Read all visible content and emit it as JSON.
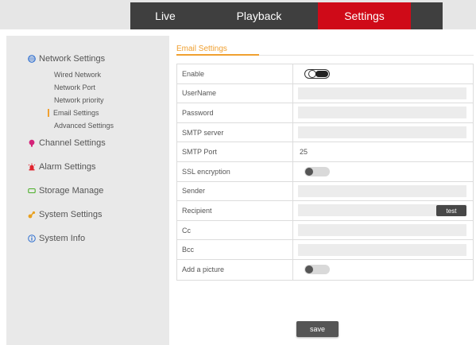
{
  "topnav": {
    "tabs": [
      {
        "label": "Live"
      },
      {
        "label": "Playback"
      },
      {
        "label": "Settings",
        "active": true
      }
    ],
    "accent_color": "#cf0a18"
  },
  "sidebar": {
    "network": {
      "label": "Network Settings",
      "icon": "network-icon",
      "items": [
        {
          "label": "Wired Network"
        },
        {
          "label": "Network Port"
        },
        {
          "label": "Network priority"
        },
        {
          "label": "Email Settings",
          "active": true
        },
        {
          "label": "Advanced Settings"
        }
      ]
    },
    "channel": {
      "label": "Channel Settings",
      "icon": "channel-icon"
    },
    "alarm": {
      "label": "Alarm Settings",
      "icon": "alarm-icon"
    },
    "storage": {
      "label": "Storage Manage",
      "icon": "storage-icon"
    },
    "system": {
      "label": "System Settings",
      "icon": "system-icon"
    },
    "info": {
      "label": "System Info",
      "icon": "info-icon"
    }
  },
  "main": {
    "title": "Email Settings",
    "accent_color": "#f0a030",
    "fields": {
      "enable": {
        "label": "Enable",
        "state": "on"
      },
      "username": {
        "label": "UserName",
        "value": ""
      },
      "password": {
        "label": "Password",
        "value": ""
      },
      "smtp_server": {
        "label": "SMTP server",
        "value": ""
      },
      "smtp_port": {
        "label": "SMTP Port",
        "value": "25"
      },
      "ssl": {
        "label": "SSL encryption",
        "state": "off"
      },
      "sender": {
        "label": "Sender",
        "value": ""
      },
      "recipient": {
        "label": "Recipient",
        "value": "",
        "test_label": "test"
      },
      "cc": {
        "label": "Cc",
        "value": ""
      },
      "bcc": {
        "label": "Bcc",
        "value": ""
      },
      "add_picture": {
        "label": "Add a picture",
        "state": "off"
      }
    },
    "save_label": "save"
  }
}
